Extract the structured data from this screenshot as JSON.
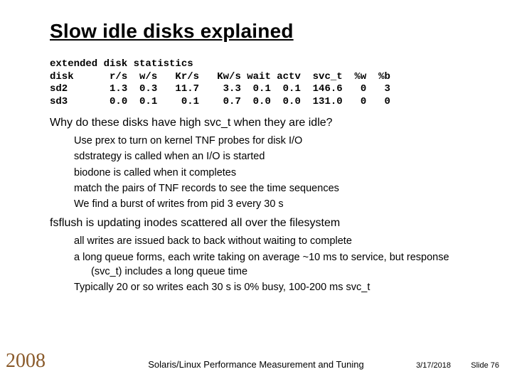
{
  "title": "Slow idle disks explained",
  "stats": {
    "line1": "extended disk statistics",
    "line2": "disk      r/s  w/s   Kr/s   Kw/s wait actv  svc_t  %w  %b",
    "line3": "sd2       1.3  0.3   11.7    3.3  0.1  0.1  146.6   0   3",
    "line4": "sd3       0.0  0.1    0.1    0.7  0.0  0.0  131.0   0   0"
  },
  "q1": "Why do these disks have high svc_t when they are idle?",
  "sub1": {
    "l1": "Use prex to turn on kernel TNF probes for disk I/O",
    "l2": "sdstrategy is called when an I/O is started",
    "l3": "biodone is called when it completes",
    "l4": "match the pairs of TNF records to see the time sequences",
    "l5": "We find a burst of writes from pid 3 every 30 s"
  },
  "q2": "fsflush is updating inodes scattered all over the filesystem",
  "sub2": {
    "l1": "all writes are issued back to back without waiting to complete",
    "l2": "a long queue forms, each write taking on average ~10 ms to service, but response (svc_t) includes a long queue time",
    "l3": "Typically 20 or so writes each 30 s is 0% busy, 100-200 ms svc_t"
  },
  "footer": {
    "year": "2008",
    "center": "Solaris/Linux Performance Measurement and Tuning",
    "date": "3/17/2018",
    "slide": "Slide 76"
  }
}
